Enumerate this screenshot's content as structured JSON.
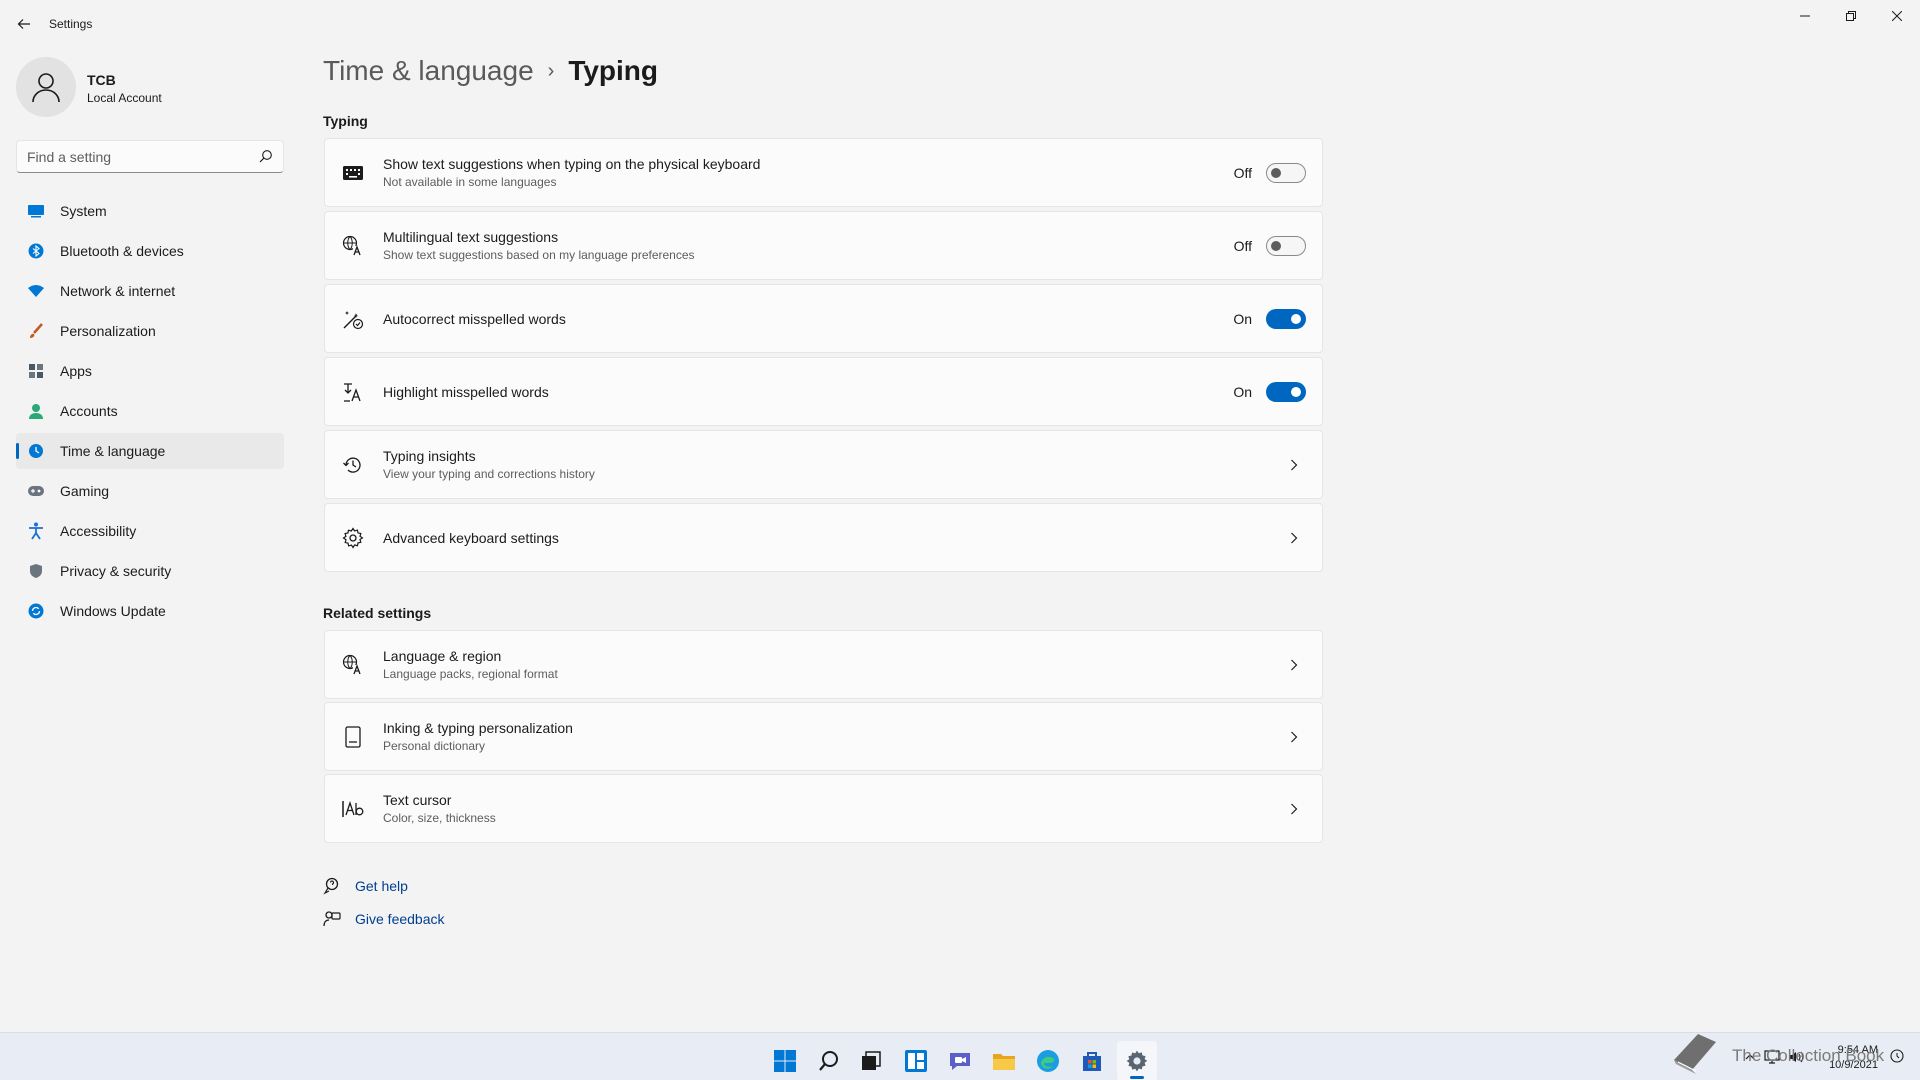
{
  "window": {
    "title": "Settings"
  },
  "user": {
    "name": "TCB",
    "account_type": "Local Account"
  },
  "search": {
    "placeholder": "Find a setting"
  },
  "sidebar": {
    "items": [
      {
        "label": "System",
        "icon": "monitor-icon",
        "color": "#0078d4"
      },
      {
        "label": "Bluetooth & devices",
        "icon": "bluetooth-icon",
        "color": "#0078d4"
      },
      {
        "label": "Network & internet",
        "icon": "wifi-icon",
        "color": "#0078d4"
      },
      {
        "label": "Personalization",
        "icon": "brush-icon",
        "color": "#c05a20"
      },
      {
        "label": "Apps",
        "icon": "apps-icon",
        "color": "#4a5866"
      },
      {
        "label": "Accounts",
        "icon": "person-icon",
        "color": "#2aa876"
      },
      {
        "label": "Time & language",
        "icon": "globe-clock-icon",
        "color": "#0078d4",
        "active": true
      },
      {
        "label": "Gaming",
        "icon": "gamepad-icon",
        "color": "#6b7580"
      },
      {
        "label": "Accessibility",
        "icon": "accessibility-icon",
        "color": "#1a6fd4"
      },
      {
        "label": "Privacy & security",
        "icon": "shield-icon",
        "color": "#6b7580"
      },
      {
        "label": "Windows Update",
        "icon": "update-icon",
        "color": "#0078d4"
      }
    ]
  },
  "breadcrumb": {
    "parent": "Time & language",
    "separator": "›",
    "current": "Typing"
  },
  "typing_section": {
    "title": "Typing",
    "items": [
      {
        "title": "Show text suggestions when typing on the physical keyboard",
        "subtitle": "Not available in some languages",
        "icon": "keyboard-icon",
        "state": "Off"
      },
      {
        "title": "Multilingual text suggestions",
        "subtitle": "Show text suggestions based on my language preferences",
        "icon": "language-icon",
        "state": "Off"
      },
      {
        "title": "Autocorrect misspelled words",
        "subtitle": "",
        "icon": "autocorrect-icon",
        "state": "On"
      },
      {
        "title": "Highlight misspelled words",
        "subtitle": "",
        "icon": "highlight-icon",
        "state": "On"
      },
      {
        "title": "Typing insights",
        "subtitle": "View your typing and corrections history",
        "icon": "history-icon"
      },
      {
        "title": "Advanced keyboard settings",
        "subtitle": "",
        "icon": "gear-icon"
      }
    ]
  },
  "related_section": {
    "title": "Related settings",
    "items": [
      {
        "title": "Language & region",
        "subtitle": "Language packs, regional format",
        "icon": "language-icon"
      },
      {
        "title": "Inking & typing personalization",
        "subtitle": "Personal dictionary",
        "icon": "notebook-icon"
      },
      {
        "title": "Text cursor",
        "subtitle": "Color, size, thickness",
        "icon": "text-cursor-icon"
      }
    ]
  },
  "links": {
    "get_help": "Get help",
    "give_feedback": "Give feedback"
  },
  "taskbar": {
    "apps": [
      "start-icon",
      "search-icon",
      "task-view-icon",
      "widgets-icon",
      "chat-icon",
      "file-explorer-icon",
      "edge-icon",
      "store-icon",
      "settings-icon"
    ],
    "active_app": "settings-icon",
    "time": "9:54 AM",
    "date": "10/9/2021",
    "watermark": "The Collection Book"
  },
  "colors": {
    "accent": "#0067c0",
    "link": "#003e92",
    "background": "#f3f3f3",
    "card": "#fbfbfb"
  }
}
